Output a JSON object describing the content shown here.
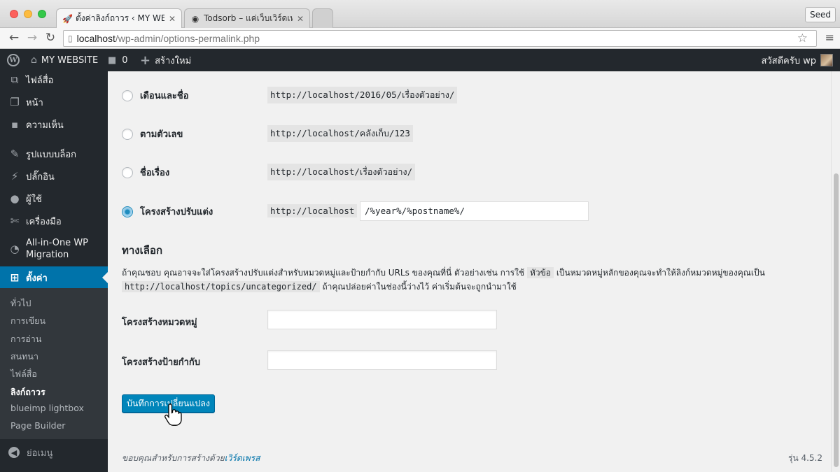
{
  "browser": {
    "tabs": [
      {
        "title": "ตั้งค่าลิงก์ถาวร ‹ MY WEBSITE",
        "favicon": "rocket-icon",
        "active": true
      },
      {
        "title": "Todsorb – แค่เว็บเวิร์ดเพรสเว็บ",
        "favicon": "github-icon",
        "active": false
      }
    ],
    "profile": "Seed",
    "url_host": "localhost",
    "url_path": "/wp-admin/options-permalink.php"
  },
  "adminbar": {
    "site_name": "MY WEBSITE",
    "comments_count": "0",
    "new_label": "สร้างใหม่",
    "greeting": "สวัสดีครับ wp"
  },
  "sidebar": {
    "items": [
      {
        "label": "ไฟล์สื่อ",
        "icon": "media-icon"
      },
      {
        "label": "หน้า",
        "icon": "pages-icon"
      },
      {
        "label": "ความเห็น",
        "icon": "comments-icon"
      },
      {
        "label": "รูปแบบบล็อก",
        "icon": "appearance-icon"
      },
      {
        "label": "ปลั๊กอิน",
        "icon": "plugins-icon"
      },
      {
        "label": "ผู้ใช้",
        "icon": "users-icon"
      },
      {
        "label": "เครื่องมือ",
        "icon": "tools-icon"
      },
      {
        "label": "All-in-One WP Migration",
        "icon": "migration-icon"
      },
      {
        "label": "ตั้งค่า",
        "icon": "settings-icon"
      }
    ],
    "submenu": [
      "ทั่วไป",
      "การเขียน",
      "การอ่าน",
      "สนทนา",
      "ไฟล์สื่อ",
      "ลิงก์ถาวร",
      "blueimp lightbox",
      "Page Builder"
    ],
    "collapse_label": "ย่อเมนู"
  },
  "options": [
    {
      "label": "เดือนและชื่อ",
      "example": "http://localhost/2016/05/เรื่องตัวอย่าง/",
      "checked": false
    },
    {
      "label": "ตามตัวเลข",
      "example": "http://localhost/คลังเก็บ/123",
      "checked": false
    },
    {
      "label": "ชื่อเรื่อง",
      "example": "http://localhost/เรื่องตัวอย่าง/",
      "checked": false
    },
    {
      "label": "โครงสร้างปรับแต่ง",
      "example": "http://localhost",
      "checked": true
    }
  ],
  "custom_structure_value": "/%year%/%postname%/",
  "optional": {
    "title": "ทางเลือก",
    "desc_part1": "ถ้าคุณชอบ คุณอาจจะใส่โครงสร้างปรับแต่งสำหรับหมวดหมู่และป้ายกำกับ URLs ของคุณที่นี่ ตัวอย่างเช่น การใช้",
    "desc_code1": "หัวข้อ",
    "desc_part2": "เป็นหมวดหมู่หลักของคุณจะทำให้ลิงก์หมวดหมู่ของคุณเป็น",
    "desc_code2": "http://localhost/topics/uncategorized/",
    "desc_part3": "ถ้าคุณปล่อยค่าในช่องนี้ว่างไว้ ค่าเริ่มต้นจะถูกนำมาใช้",
    "category_label": "โครงสร้างหมวดหมู่",
    "tag_label": "โครงสร้างป้ายกำกับ"
  },
  "save_label": "บันทึกการเปลี่ยนแปลง",
  "footer": {
    "thanks_prefix": "ขอบคุณสำหรับการสร้างด้วย",
    "thanks_link": "เวิร์ดเพรส",
    "version": "รุ่น 4.5.2"
  }
}
